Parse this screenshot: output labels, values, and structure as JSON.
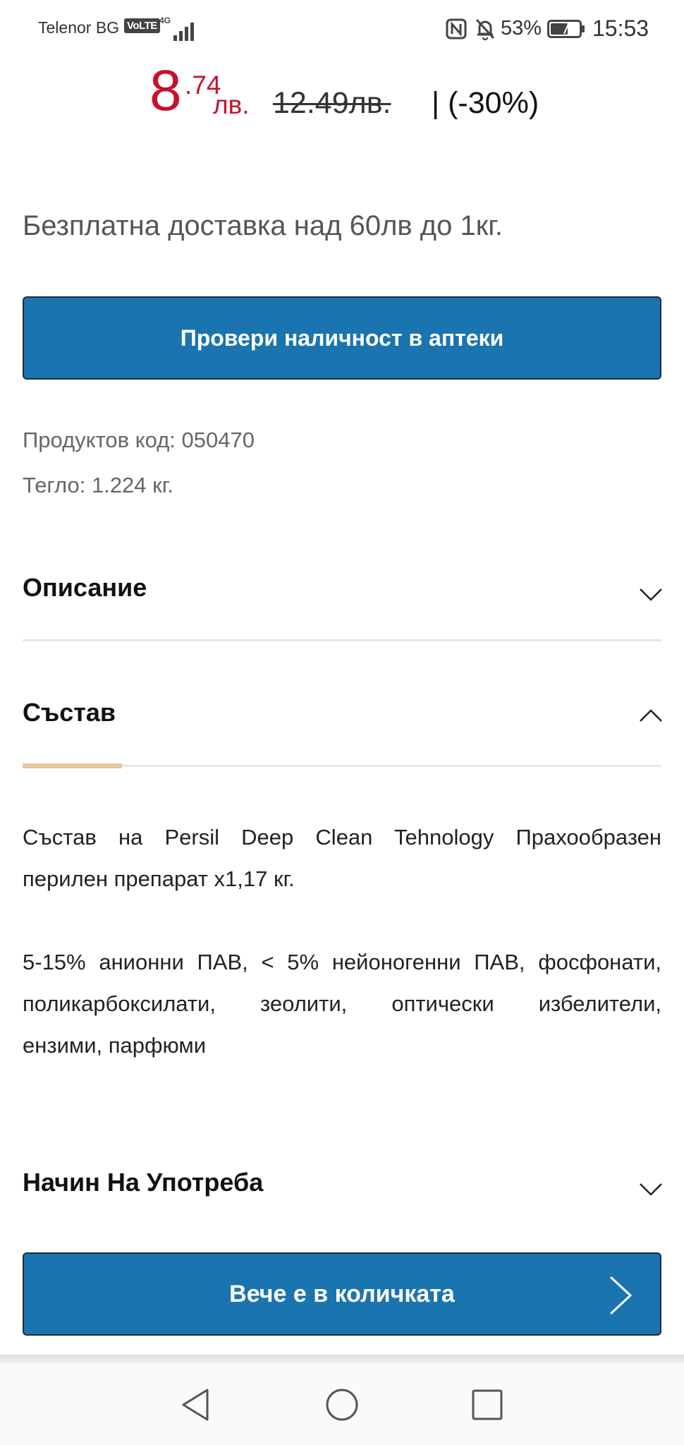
{
  "status_bar": {
    "carrier": "Telenor BG",
    "volte": "VoLTE",
    "network": "4G",
    "battery_percent": "53%",
    "time": "15:53",
    "icons": [
      "signal-icon",
      "nfc-icon",
      "muted-bell-icon",
      "battery-icon"
    ]
  },
  "product": {
    "price_integer": "8",
    "price_decimal": ".74",
    "price_currency": "лв.",
    "old_price": "12.49лв.",
    "discount": "| (-30%)",
    "price_color": "#c8102e",
    "delivery_note": "Безплатна доставка над 60лв до 1кг.",
    "check_availability_label": "Провери наличност в аптеки",
    "product_code": "Продуктов код: 050470",
    "weight": "Тегло: 1.224 кг."
  },
  "accordion": {
    "description": {
      "title": "Описание",
      "expanded": false
    },
    "composition": {
      "title": "Състав",
      "expanded": true,
      "paragraph1_line1": "Състав на Persil Deep Clean Tehnology Прахообразен",
      "paragraph1_line2": "перилен препарат  x1,17 кг.",
      "paragraph2_line1": "5-15% анионни ПАВ, < 5% нейоногенни ПАВ, фосфонати,",
      "paragraph2_line2": "поликарбоксилати, зеолити, оптически избелители,",
      "paragraph2_line3": "ензими, парфюми"
    },
    "usage": {
      "title": "Начин На Употреба",
      "expanded": false
    }
  },
  "cart_button": {
    "label": "Вече е в количката"
  },
  "colors": {
    "primary_button": "#1a74b0",
    "accent_bar": "#e9c89c"
  },
  "nav_bar": {
    "buttons": [
      "back-icon",
      "home-icon",
      "recents-icon"
    ]
  }
}
